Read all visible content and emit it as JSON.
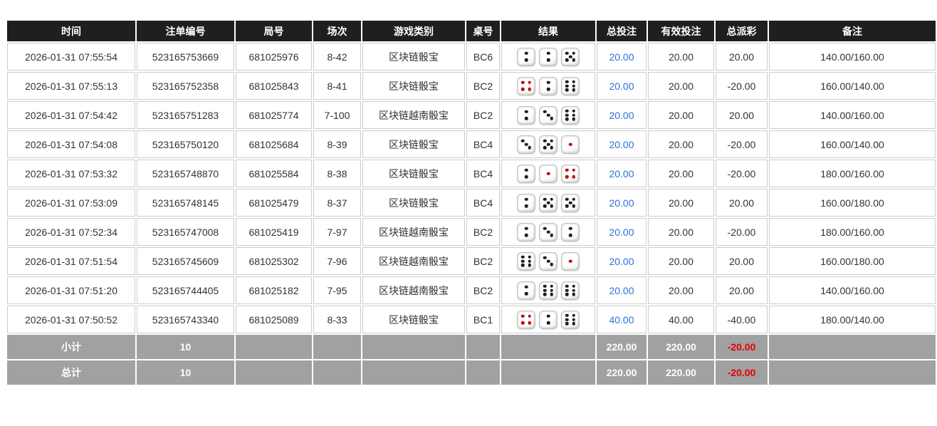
{
  "colors": {
    "header_bg": "#1f1f1f",
    "summary_bg": "#a1a1a1",
    "link_blue": "#2a72d9",
    "negative_red": "#e60000",
    "cell_border": "#cccccc"
  },
  "table": {
    "headers": [
      "时间",
      "注单编号",
      "局号",
      "场次",
      "游戏类别",
      "桌号",
      "结果",
      "总投注",
      "有效投注",
      "总派彩",
      "备注"
    ],
    "rows": [
      {
        "time": "2026-01-31 07:55:54",
        "bet_id": "523165753669",
        "round_no": "681025976",
        "session": "8-42",
        "game_type": "区块链骰宝",
        "table_no": "BC6",
        "dice": [
          2,
          2,
          5
        ],
        "total_bet": "20.00",
        "valid_bet": "20.00",
        "payout": "20.00",
        "remark": "140.00/160.00"
      },
      {
        "time": "2026-01-31 07:55:13",
        "bet_id": "523165752358",
        "round_no": "681025843",
        "session": "8-41",
        "game_type": "区块链骰宝",
        "table_no": "BC2",
        "dice": [
          4,
          2,
          6
        ],
        "total_bet": "20.00",
        "valid_bet": "20.00",
        "payout": "-20.00",
        "remark": "160.00/140.00"
      },
      {
        "time": "2026-01-31 07:54:42",
        "bet_id": "523165751283",
        "round_no": "681025774",
        "session": "7-100",
        "game_type": "区块链越南骰宝",
        "table_no": "BC2",
        "dice": [
          2,
          3,
          6
        ],
        "total_bet": "20.00",
        "valid_bet": "20.00",
        "payout": "20.00",
        "remark": "140.00/160.00"
      },
      {
        "time": "2026-01-31 07:54:08",
        "bet_id": "523165750120",
        "round_no": "681025684",
        "session": "8-39",
        "game_type": "区块链骰宝",
        "table_no": "BC4",
        "dice": [
          3,
          5,
          1
        ],
        "total_bet": "20.00",
        "valid_bet": "20.00",
        "payout": "-20.00",
        "remark": "160.00/140.00"
      },
      {
        "time": "2026-01-31 07:53:32",
        "bet_id": "523165748870",
        "round_no": "681025584",
        "session": "8-38",
        "game_type": "区块链骰宝",
        "table_no": "BC4",
        "dice": [
          2,
          1,
          4
        ],
        "total_bet": "20.00",
        "valid_bet": "20.00",
        "payout": "-20.00",
        "remark": "180.00/160.00"
      },
      {
        "time": "2026-01-31 07:53:09",
        "bet_id": "523165748145",
        "round_no": "681025479",
        "session": "8-37",
        "game_type": "区块链骰宝",
        "table_no": "BC4",
        "dice": [
          2,
          5,
          5
        ],
        "total_bet": "20.00",
        "valid_bet": "20.00",
        "payout": "20.00",
        "remark": "160.00/180.00"
      },
      {
        "time": "2026-01-31 07:52:34",
        "bet_id": "523165747008",
        "round_no": "681025419",
        "session": "7-97",
        "game_type": "区块链越南骰宝",
        "table_no": "BC2",
        "dice": [
          2,
          3,
          2
        ],
        "total_bet": "20.00",
        "valid_bet": "20.00",
        "payout": "-20.00",
        "remark": "180.00/160.00"
      },
      {
        "time": "2026-01-31 07:51:54",
        "bet_id": "523165745609",
        "round_no": "681025302",
        "session": "7-96",
        "game_type": "区块链越南骰宝",
        "table_no": "BC2",
        "dice": [
          6,
          3,
          1
        ],
        "total_bet": "20.00",
        "valid_bet": "20.00",
        "payout": "20.00",
        "remark": "160.00/180.00"
      },
      {
        "time": "2026-01-31 07:51:20",
        "bet_id": "523165744405",
        "round_no": "681025182",
        "session": "7-95",
        "game_type": "区块链越南骰宝",
        "table_no": "BC2",
        "dice": [
          2,
          6,
          6
        ],
        "total_bet": "20.00",
        "valid_bet": "20.00",
        "payout": "20.00",
        "remark": "140.00/160.00"
      },
      {
        "time": "2026-01-31 07:50:52",
        "bet_id": "523165743340",
        "round_no": "681025089",
        "session": "8-33",
        "game_type": "区块链骰宝",
        "table_no": "BC1",
        "dice": [
          4,
          2,
          6
        ],
        "total_bet": "40.00",
        "valid_bet": "40.00",
        "payout": "-40.00",
        "remark": "180.00/140.00"
      }
    ],
    "subtotal": {
      "label": "小计",
      "count": "10",
      "total_bet": "220.00",
      "valid_bet": "220.00",
      "payout": "-20.00"
    },
    "total": {
      "label": "总计",
      "count": "10",
      "total_bet": "220.00",
      "valid_bet": "220.00",
      "payout": "-20.00"
    }
  }
}
